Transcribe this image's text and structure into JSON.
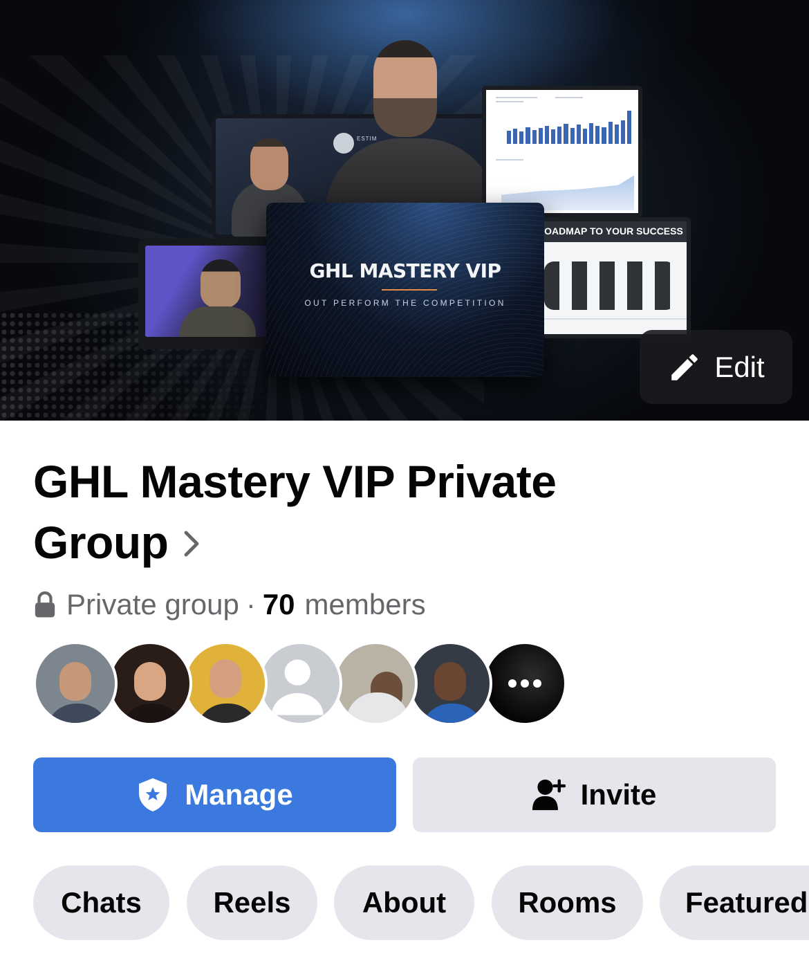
{
  "cover": {
    "card_title": "GHL MASTERY VIP",
    "card_subtitle": "OUT PERFORM THE COMPETITION",
    "roadmap_title": "ROADMAP TO YOUR SUCCESS",
    "edit_label": "Edit",
    "edit_icon": "pencil-icon"
  },
  "group": {
    "title_line1": "GHL Mastery VIP Private",
    "title_line2": "Group",
    "privacy": "Private group",
    "separator": "·",
    "member_count": "70",
    "members_word": "members",
    "privacy_icon": "lock-icon"
  },
  "avatars": {
    "count_shown": 6,
    "more_icon": "more-dots-icon"
  },
  "actions": {
    "manage_label": "Manage",
    "manage_icon": "shield-star-icon",
    "invite_label": "Invite",
    "invite_icon": "add-person-icon",
    "manage_color": "#3b79df"
  },
  "tabs": [
    "Chats",
    "Reels",
    "About",
    "Rooms",
    "Featured"
  ]
}
